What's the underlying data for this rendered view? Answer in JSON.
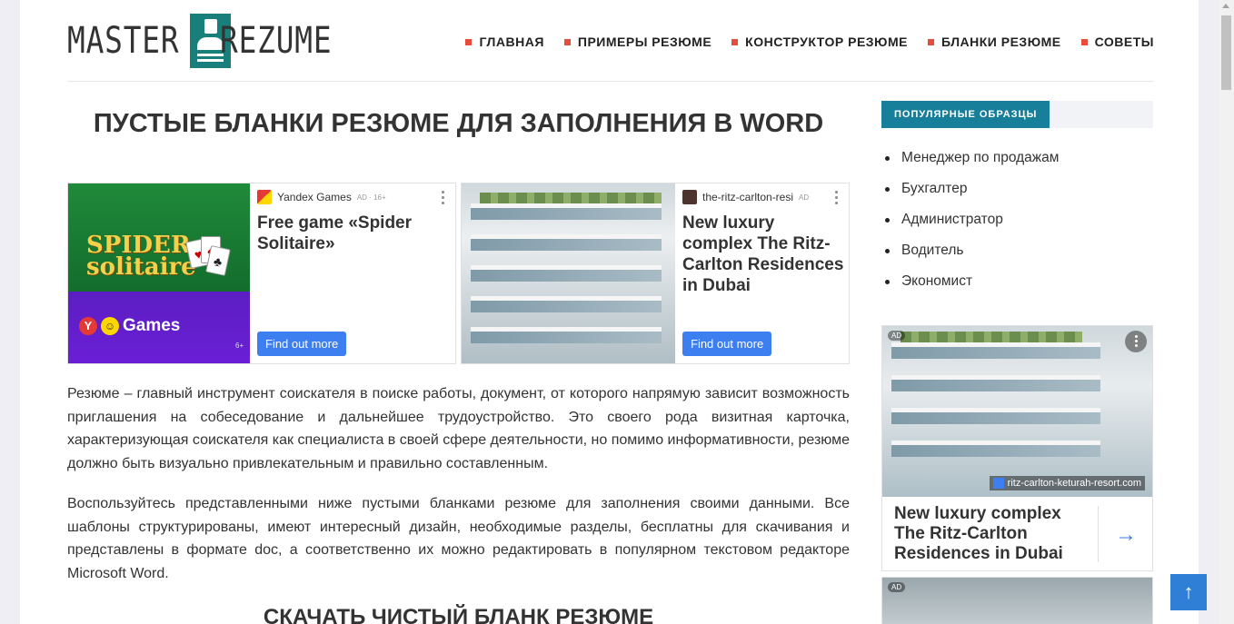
{
  "logo": {
    "part1": "MASTER",
    "part2": "REZUME"
  },
  "nav": [
    {
      "label": "ГЛАВНАЯ"
    },
    {
      "label": "ПРИМЕРЫ РЕЗЮМЕ"
    },
    {
      "label": "КОНСТРУКТОР РЕЗЮМЕ"
    },
    {
      "label": "БЛАНКИ РЕЗЮМЕ"
    },
    {
      "label": "СОВЕТЫ"
    }
  ],
  "colors": {
    "accent": "#187f7a",
    "nav_marker": "#e74c3c",
    "ad_button": "#3d7ef0",
    "sidebar_head": "#187f9a"
  },
  "main": {
    "title": "ПУСТЫЕ БЛАНКИ РЕЗЮМЕ ДЛЯ ЗАПОЛНЕНИЯ В WORD",
    "ads": [
      {
        "image_text_1": "SPIDER",
        "image_text_2": "solitaire",
        "image_brand": "Games",
        "image_age": "6+",
        "source": "Yandex Games",
        "flag": "AD · 16+",
        "headline": "Free game «Spider Solitaire»",
        "button": "Find out more"
      },
      {
        "source": "the-ritz-carlton-resi",
        "flag": "AD",
        "headline": "New luxury complex The Ritz-Carlton Residences in Dubai",
        "button": "Find out more"
      }
    ],
    "paragraph1": "Резюме – главный инструмент соискателя в поиске работы, документ, от которого напрямую зависит возможность приглашения на собеседование и дальнейшее трудоустройство. Это своего рода визитная карточка, характеризующая соискателя как специалиста в своей сфере деятельности, но помимо информативности, резюме должно быть визуально привлекательным и правильно составленным.",
    "paragraph2": "Воспользуйтесь представленными ниже пустыми бланками резюме для заполнения своими данными. Все шаблоны структурированы, имеют интересный дизайн, необходимые разделы, бесплатны для скачивания и представлены в формате doc, а соответственно их можно редактировать в популярном текстовом редакторе Microsoft Word.",
    "subheading": "СКАЧАТЬ ЧИСТЫЙ БЛАНК РЕЗЮМЕ"
  },
  "sidebar": {
    "heading": "ПОПУЛЯРНЫЕ ОБРАЗЦЫ",
    "items": [
      "Менеджер по продажам",
      "Бухгалтер",
      "Администратор",
      "Водитель",
      "Экономист"
    ],
    "ad": {
      "tag": "AD",
      "domain": "ritz-carlton-keturah-resort.com",
      "headline": "New luxury complex The Ritz-Carlton Residences in Dubai",
      "arrow": "→"
    },
    "ad2": {
      "tag": "AD"
    }
  },
  "scroll_top": {
    "icon": "arrow-up-icon",
    "glyph": "↑"
  }
}
